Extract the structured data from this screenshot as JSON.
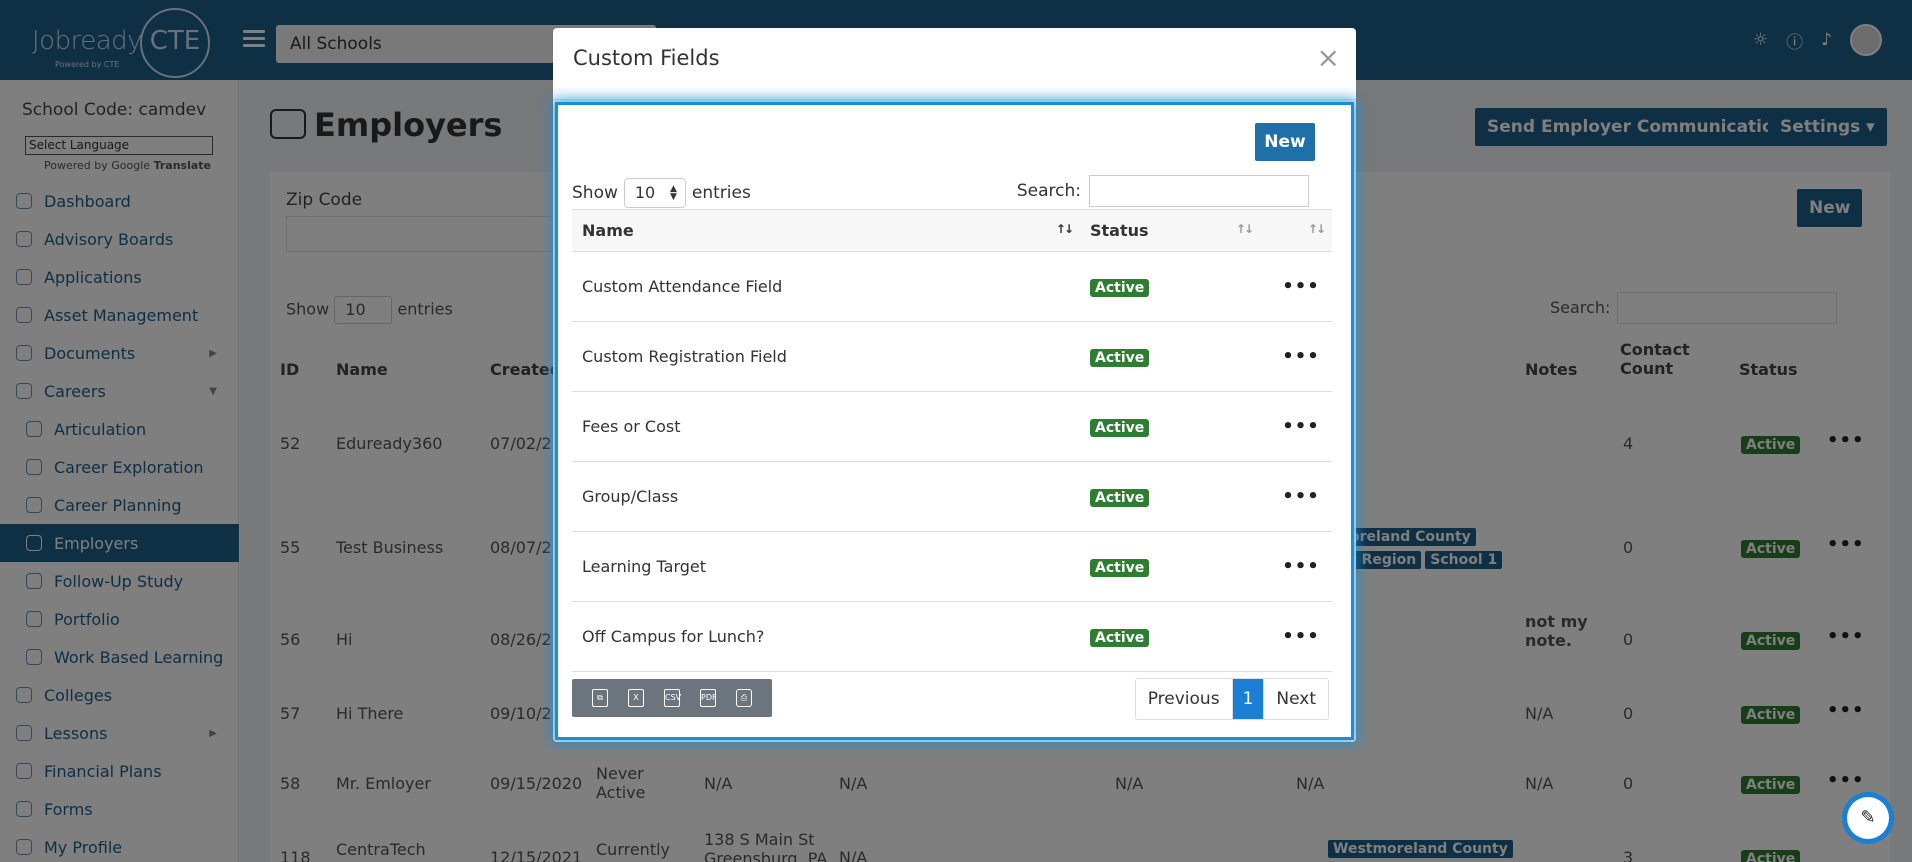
{
  "header": {
    "logo_text": "Jobready",
    "logo_cte": "CTE",
    "logo_sub": "Powered by CTE",
    "school_filter": "All Schools"
  },
  "sidebar": {
    "school_code": "School Code: camdev",
    "language_select": "Select Language",
    "powered_by": "Powered by",
    "google": "Google",
    "translate": "Translate",
    "items": [
      {
        "label": "Dashboard"
      },
      {
        "label": "Advisory Boards"
      },
      {
        "label": "Applications"
      },
      {
        "label": "Asset Management"
      },
      {
        "label": "Documents"
      },
      {
        "label": "Careers"
      },
      {
        "label": "Articulation"
      },
      {
        "label": "Career Exploration"
      },
      {
        "label": "Career Planning"
      },
      {
        "label": "Employers"
      },
      {
        "label": "Follow-Up Study"
      },
      {
        "label": "Portfolio"
      },
      {
        "label": "Work Based Learning"
      },
      {
        "label": "Colleges"
      },
      {
        "label": "Lessons"
      },
      {
        "label": "Financial Plans"
      },
      {
        "label": "Forms"
      },
      {
        "label": "My Profile"
      }
    ]
  },
  "page": {
    "title": "Employers",
    "send_comms": "Send Employer Communications",
    "settings": "Settings",
    "new": "New",
    "zip_label": "Zip Code",
    "show": "Show",
    "show_value": "10",
    "entries": "entries",
    "search": "Search:",
    "columns": {
      "id": "ID",
      "name": "Name",
      "created": "Created",
      "notes": "Notes",
      "contact_count_1": "Contact",
      "contact_count_2": "Count",
      "status": "Status"
    },
    "rows": [
      {
        "id": "52",
        "name": "Eduready360",
        "created": "07/02/2",
        "contact": "4",
        "status": "Active"
      },
      {
        "id": "55",
        "name": "Test Business",
        "created": "08/07/2",
        "contact": "0",
        "status": "Active",
        "tag1": "oreland County",
        "tag2": "t Region",
        "tag3": "School 1"
      },
      {
        "id": "56",
        "name": "Hi",
        "created": "08/26/2",
        "notes_1": "not my",
        "notes_2": "note.",
        "contact": "0",
        "status": "Active"
      },
      {
        "id": "57",
        "name": "Hi There",
        "created": "09/10/2",
        "notes": "N/A",
        "contact": "0",
        "status": "Active"
      },
      {
        "id": "58",
        "name": "Mr. Emloyer",
        "created": "09/15/2020",
        "activity_1": "Never",
        "activity_2": "Active",
        "c1": "N/A",
        "c2": "N/A",
        "c3": "N/A",
        "c4": "N/A",
        "notes": "N/A",
        "contact": "0",
        "status": "Active"
      },
      {
        "id": "118",
        "name": "CentraTech",
        "created": "12/15/2021",
        "activity": "Currently",
        "addr_1": "138 S Main St",
        "addr_2": "Greensburg, PA",
        "c2": "N/A",
        "tag": "Westmoreland County",
        "contact": "3",
        "status": "Active"
      }
    ]
  },
  "modal": {
    "title": "Custom Fields",
    "close": "×",
    "new_button": "New",
    "show": "Show",
    "show_value": "10",
    "entries": "entries",
    "search_label": "Search:",
    "search_value": "",
    "col_name": "Name",
    "col_status": "Status",
    "rows": [
      {
        "name": "Custom Attendance Field",
        "status": "Active"
      },
      {
        "name": "Custom Registration Field",
        "status": "Active"
      },
      {
        "name": "Fees or Cost",
        "status": "Active"
      },
      {
        "name": "Group/Class",
        "status": "Active"
      },
      {
        "name": "Learning Target",
        "status": "Active"
      },
      {
        "name": "Off Campus for Lunch?",
        "status": "Active"
      }
    ],
    "export_buttons": [
      "copy-icon",
      "excel-icon",
      "csv-icon",
      "pdf-icon",
      "print-icon"
    ],
    "pager": {
      "previous": "Previous",
      "current": "1",
      "next": "Next"
    }
  },
  "colors": {
    "brand": "#1f5f8b",
    "active_badge": "#2e7d32",
    "focus": "#1b8fd6"
  }
}
